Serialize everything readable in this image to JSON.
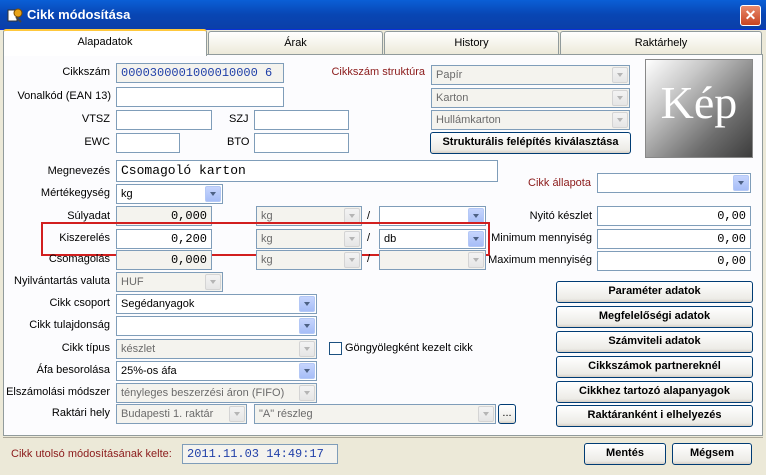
{
  "window": {
    "title": "Cikk módosítása",
    "close_glyph": "✕"
  },
  "tabs": [
    "Alapadatok",
    "Árak",
    "History",
    "Raktárhely"
  ],
  "form": {
    "cikkszam_label": "Cikkszám",
    "cikkszam_value": "0000300001000010000 6",
    "cikkszam_struktura_label": "Cikkszám struktúra",
    "struktura": [
      "Papír",
      "Karton",
      "Hullámkarton"
    ],
    "strukturalis_button": "Strukturális felépítés kiválasztása",
    "vonalkod_label": "Vonalkód (EAN 13)",
    "vonalkod_value": "",
    "vtsz_label": "VTSZ",
    "vtsz_value": "",
    "szj_label": "SZJ",
    "szj_value": "",
    "ewc_label": "EWC",
    "ewc_value": "",
    "bto_label": "BTO",
    "bto_value": "",
    "image_text": "Kép",
    "megnevezes_label": "Megnevezés",
    "megnevezes_value": "Csomagoló karton",
    "mertekegyseg_label": "Mértékegység",
    "mertekegyseg_value": "kg",
    "cikk_allapota_label": "Cikk állapota",
    "cikk_allapota_value": "",
    "slash": "/",
    "sulyadat": {
      "label": "Súlyadat",
      "value": "0,000",
      "unit": "kg",
      "unit2": ""
    },
    "kiszereles": {
      "label": "Kiszerelés",
      "value": "0,200",
      "unit": "kg",
      "unit2": "db"
    },
    "csomagolas": {
      "label": "Csomagolás",
      "value": "0,000",
      "unit": "kg",
      "unit2": ""
    },
    "nyito_keszlet": {
      "label": "Nyitó készlet",
      "value": "0,00"
    },
    "minimum": {
      "label": "Minimum mennyiség",
      "value": "0,00"
    },
    "maximum": {
      "label": "Maximum mennyiség",
      "value": "0,00"
    },
    "nyilvantartas_label": "Nyilvántartás valuta",
    "nyilvantartas_value": "HUF",
    "cikk_csoport_label": "Cikk csoport",
    "cikk_csoport_value": "Segédanyagok",
    "cikk_tulajdonsag_label": "Cikk tulajdonság",
    "cikk_tulajdonsag_value": "",
    "cikk_tipus_label": "Cikk típus",
    "cikk_tipus_value": "készlet",
    "gongyoleg_label": "Göngyölegként kezelt cikk",
    "afa_label": "Áfa besorolása",
    "afa_value": "25%-os áfa",
    "elszamolasi_label": "Elszámolási módszer",
    "elszamolasi_value": "tényleges beszerzési áron (FIFO)",
    "raktari_hely_label": "Raktári hely",
    "raktar_value": "Budapesti 1. raktár",
    "reszleg_value": "\"A\" részleg",
    "ellipsis": "..."
  },
  "side_buttons": [
    "Paraméter adatok",
    "Megfelelőségi adatok",
    "Számviteli adatok",
    "Cikkszámok partnereknél",
    "Cikkhez tartozó alapanyagok",
    "Raktáranként i elhelyezés"
  ],
  "footer": {
    "last_modified_label": "Cikk utolsó módosításának kelte:",
    "last_modified_value": "2011.11.03 14:49:17",
    "save": "Mentés",
    "cancel": "Mégsem"
  }
}
